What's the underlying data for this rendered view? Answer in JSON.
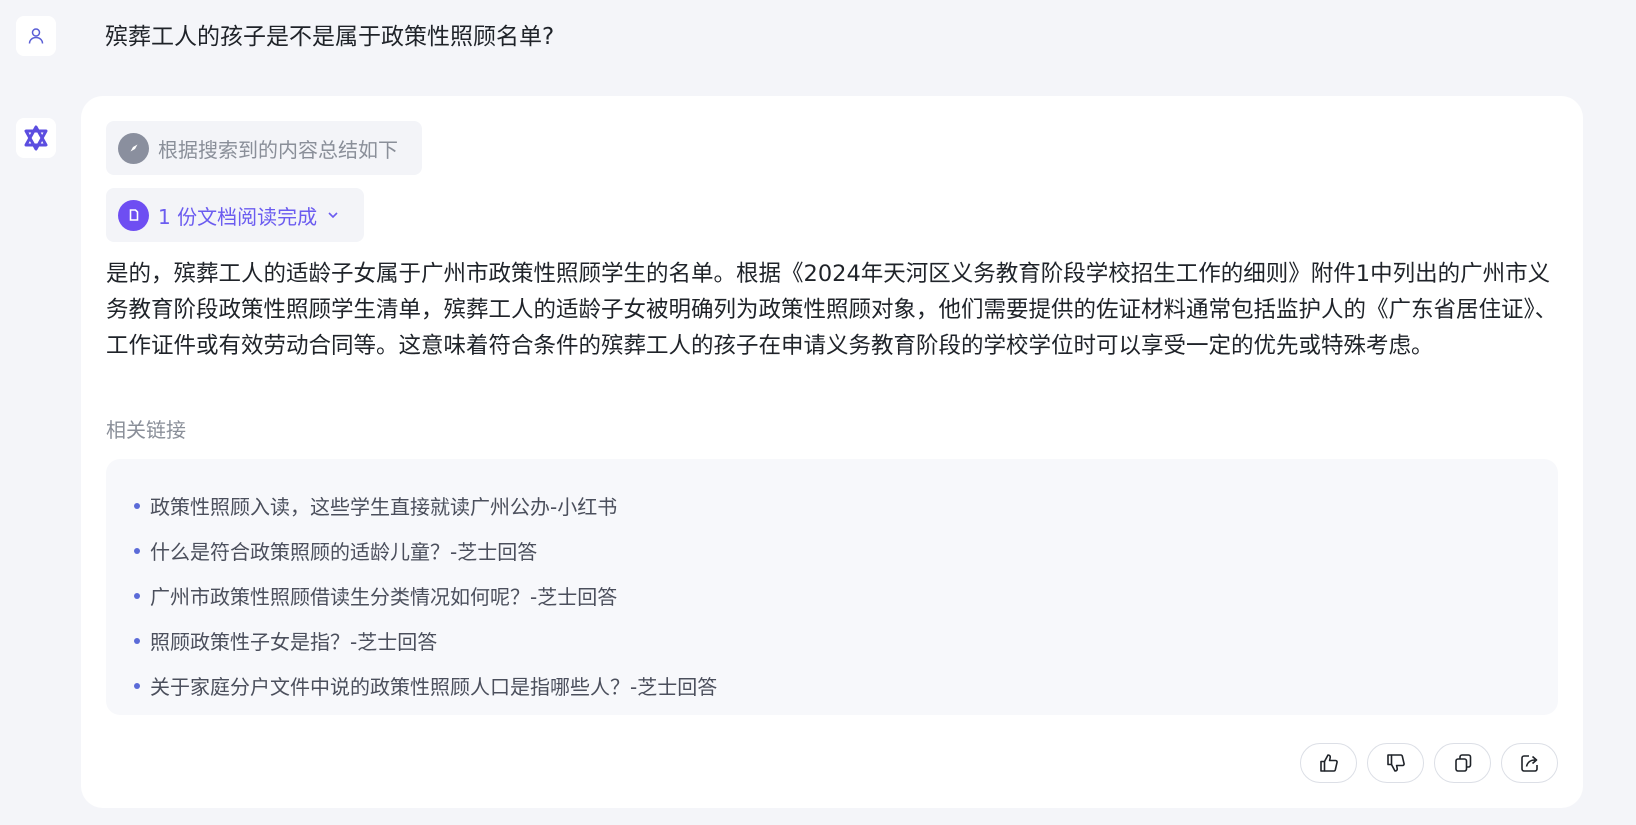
{
  "user": {
    "avatar_icon": "user-icon",
    "question": "殡葬工人的孩子是不是属于政策性照顾名单?"
  },
  "bot": {
    "avatar_icon": "assistant-logo-icon",
    "summary_label": "根据搜索到的内容总结如下",
    "summary_icon": "compass-icon",
    "docs_label": "1 份文档阅读完成",
    "docs_icon": "document-icon",
    "docs_chevron_icon": "chevron-down-icon",
    "answer": "是的，殡葬工人的适龄子女属于广州市政策性照顾学生的名单。根据《2024年天河区义务教育阶段学校招生工作的细则》附件1中列出的广州市义务教育阶段政策性照顾学生清单，殡葬工人的适龄子女被明确列为政策性照顾对象，他们需要提供的佐证材料通常包括监护人的《广东省居住证》、工作证件或有效劳动合同等。这意味着符合条件的殡葬工人的孩子在申请义务教育阶段的学校学位时可以享受一定的优先或特殊考虑。",
    "related_title": "相关链接",
    "related_links": [
      "政策性照顾入读，这些学生直接就读广州公办-小红书",
      "什么是符合政策照顾的适龄儿童？-芝士回答",
      "广州市政策性照顾借读生分类情况如何呢？-芝士回答",
      "照顾政策性子女是指？-芝士回答",
      "关于家庭分户文件中说的政策性照顾人口是指哪些人？-芝士回答"
    ],
    "actions": [
      "thumbs-up-icon",
      "thumbs-down-icon",
      "copy-icon",
      "share-icon"
    ]
  },
  "colors": {
    "background": "#f4f5f9",
    "accent": "#6e4ef2",
    "link_bullet": "#5b6bd8"
  }
}
